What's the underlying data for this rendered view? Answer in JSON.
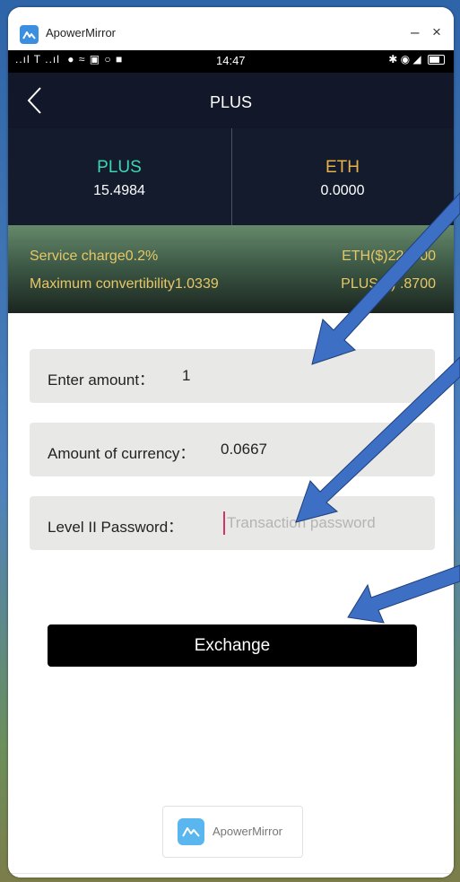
{
  "window": {
    "app_title": "ApowerMirror",
    "minimize_label": "–",
    "close_label": "×"
  },
  "status_bar": {
    "signal_text": "..ıl T ..ıl",
    "time": "14:47",
    "icons": [
      "signal-icon",
      "wifi-icon",
      "bluetooth-icon",
      "nfc-icon",
      "battery-icon"
    ]
  },
  "nav": {
    "title": "PLUS"
  },
  "balances": [
    {
      "name": "PLUS",
      "value": "15.4984",
      "color": "#3dd6b3"
    },
    {
      "name": "ETH",
      "value": "0.0000",
      "color": "#e8b24a"
    }
  ],
  "info": {
    "service_charge": "Service charge0.2%",
    "eth_price": "ETH($)222.  00",
    "max_convertibility": "Maximum convertibility1.0339",
    "plus_price": "PLUS($)  .8700"
  },
  "form": {
    "amount_label": "Enter amount：",
    "amount_value": "1",
    "currency_label": "Amount of currency：",
    "currency_value": "0.0667",
    "password_label": "Level II Password：",
    "password_placeholder": "Transaction password"
  },
  "exchange_button": "Exchange",
  "mirror_badge": "ApowerMirror",
  "colors": {
    "accent_green": "#3dd6b3",
    "accent_gold": "#e6c766",
    "annotation_arrow": "#3d6fc4"
  }
}
